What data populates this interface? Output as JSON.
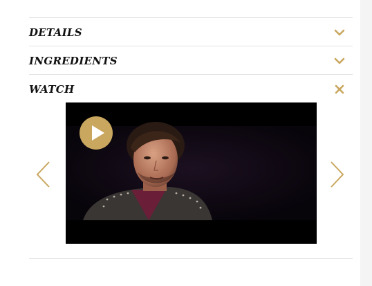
{
  "accordion": {
    "items": [
      {
        "label": "DETAILS",
        "state": "collapsed",
        "icon": "chevron-down-icon"
      },
      {
        "label": "INGREDIENTS",
        "state": "collapsed",
        "icon": "chevron-down-icon"
      },
      {
        "label": "WATCH",
        "state": "expanded",
        "icon": "close-icon"
      }
    ]
  },
  "video": {
    "play_icon": "play-icon",
    "prev_icon": "chevron-left-icon",
    "next_icon": "chevron-right-icon"
  },
  "colors": {
    "accent": "#c9a75f",
    "text": "#111111",
    "divider": "#e2e2e2",
    "video_bg": "#000000"
  }
}
